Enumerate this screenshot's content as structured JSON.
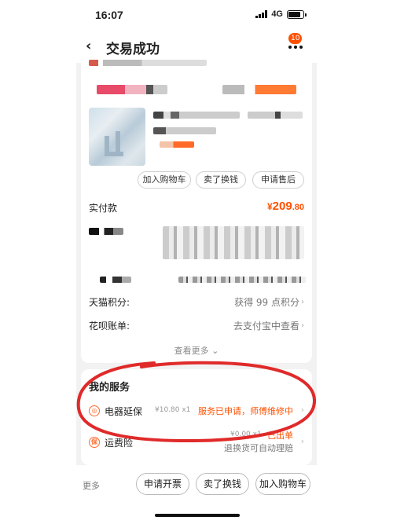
{
  "status_bar": {
    "time": "16:07",
    "network": "4G"
  },
  "header": {
    "title": "交易成功",
    "message_count": "10"
  },
  "order": {
    "buttons": [
      "加入购物车",
      "卖了换钱",
      "申请售后"
    ],
    "paid_label": "实付款",
    "paid_currency": "¥",
    "paid_integer": "209",
    "paid_decimal": ".80",
    "points_label": "天猫积分:",
    "points_value": "获得 99 点积分",
    "huabei_label": "花呗账单:",
    "huabei_value": "去支付宝中查看",
    "see_more": "查看更多"
  },
  "services": {
    "title": "我的服务",
    "items": [
      {
        "icon": "shield-icon",
        "name": "电器延保",
        "price": "¥10.80 x1",
        "status": "服务已申请，师傅维修中"
      },
      {
        "icon": "insurance-icon",
        "name": "运费险",
        "price": "¥0.00 x1",
        "status": "已出单",
        "sub": "退换货可自动理赔"
      }
    ]
  },
  "bottom_bar": {
    "more": "更多",
    "buttons": [
      "申请开票",
      "卖了换钱",
      "加入购物车"
    ]
  },
  "colors": {
    "accent": "#ff5000",
    "annotation": "#e02a2a"
  }
}
